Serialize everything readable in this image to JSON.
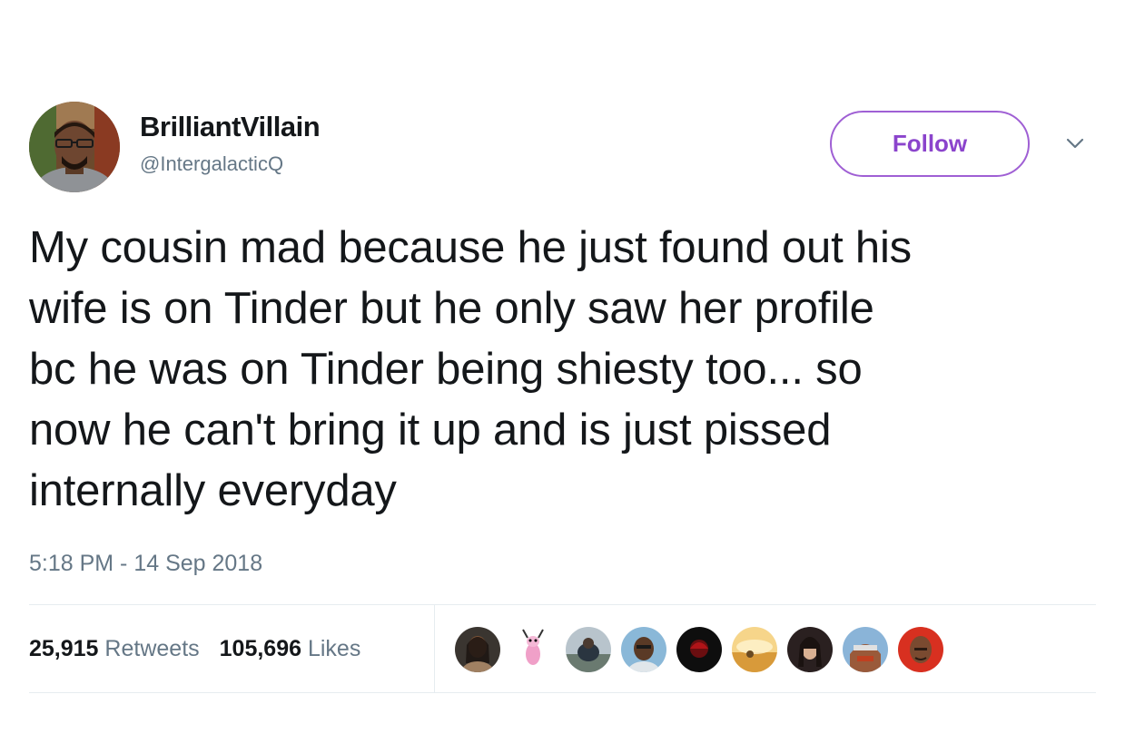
{
  "user": {
    "display_name": "BrilliantVillain",
    "handle": "@IntergalacticQ"
  },
  "follow_label": "Follow",
  "tweet": {
    "lines": [
      "My cousin mad because he just found out his",
      "wife is on Tinder but he only saw her profile",
      "bc he was on Tinder being shiesty too... so",
      "now he can't bring it up and is just pissed",
      "internally everyday"
    ],
    "timestamp": "5:18 PM - 14 Sep 2018"
  },
  "stats": {
    "retweets_count": "25,915",
    "retweets_label": "Retweets",
    "likes_count": "105,696",
    "likes_label": "Likes"
  },
  "colors": {
    "follow_accent": "#9f5fd4",
    "text_primary": "#14171a",
    "text_secondary": "#657786",
    "divider": "#e6ecf0"
  },
  "icons": {
    "menu": "chevron-down-icon"
  }
}
